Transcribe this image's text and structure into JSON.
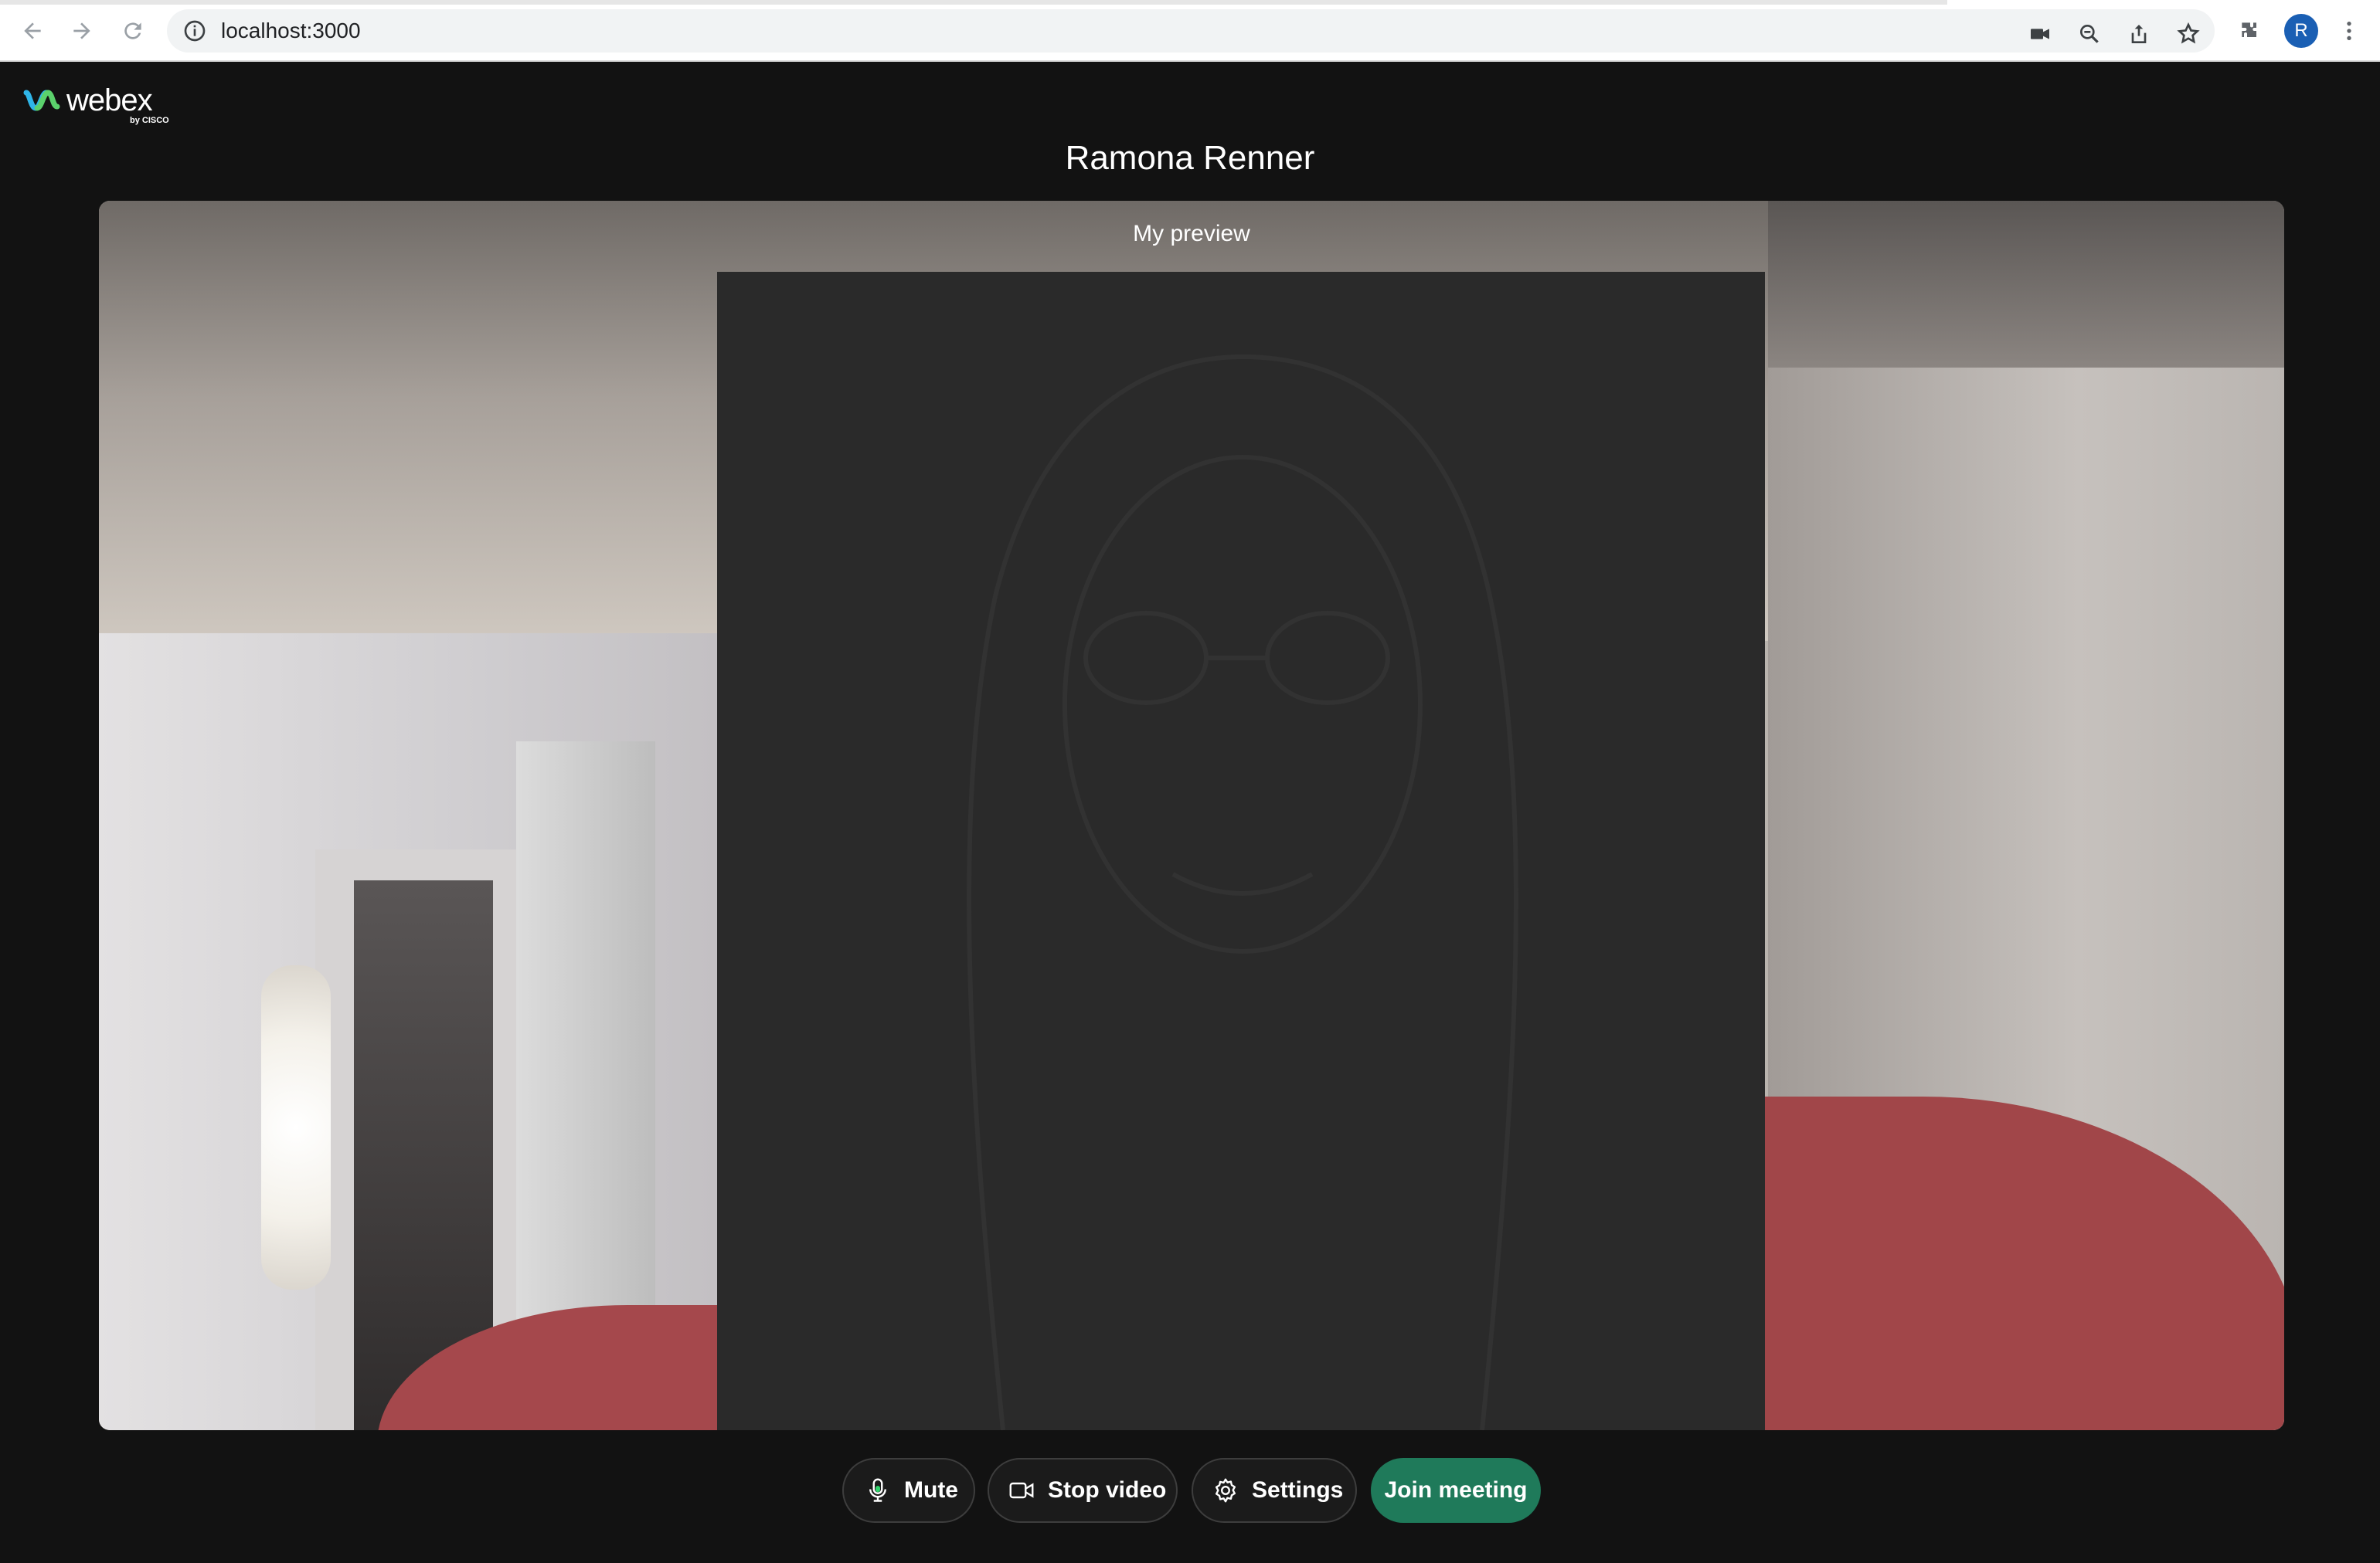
{
  "browser": {
    "url": "localhost:3000",
    "avatar_initial": "R",
    "icons": [
      "back-arrow-icon",
      "forward-arrow-icon",
      "reload-icon",
      "info-icon",
      "camera-icon",
      "zoom-icon",
      "share-icon",
      "star-icon",
      "extensions-icon",
      "kebab-menu-icon"
    ]
  },
  "app": {
    "logo_text": "webex",
    "logo_subtext": "by CISCO",
    "participant_name": "Ramona Renner",
    "preview_label": "My preview"
  },
  "controls": {
    "mute_label": "Mute",
    "stop_video_label": "Stop video",
    "settings_label": "Settings",
    "join_label": "Join meeting"
  },
  "colors": {
    "background": "#121212",
    "join_button": "#1f7a5a",
    "preview_box": "#2a2a2a"
  }
}
